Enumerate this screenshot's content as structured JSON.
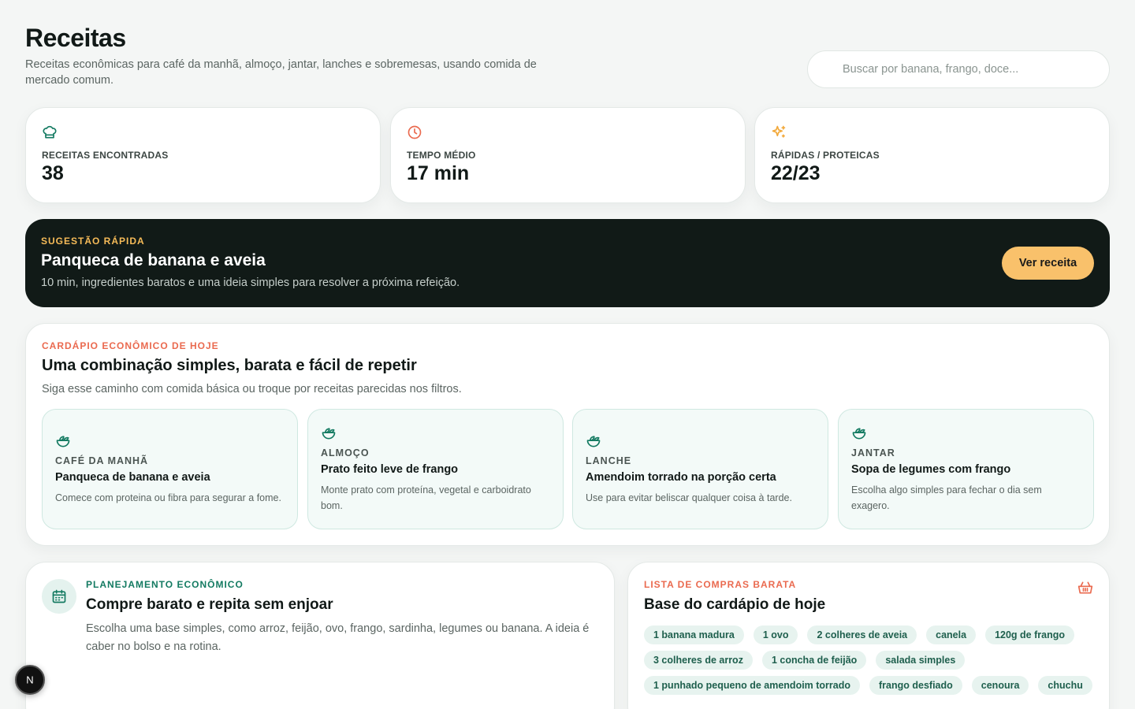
{
  "header": {
    "title": "Receitas",
    "subtitle": "Receitas econômicas para café da manhã, almoço, jantar, lanches e sobremesas, usando comida de mercado comum.",
    "search_placeholder": "Buscar por banana, frango, doce..."
  },
  "stats": [
    {
      "icon": "chef-hat-icon",
      "label": "RECEITAS ENCONTRADAS",
      "value": "38",
      "color": "#137a61"
    },
    {
      "icon": "clock-icon",
      "label": "TEMPO MÉDIO",
      "value": "17 min",
      "color": "#ea6a4f"
    },
    {
      "icon": "sparkles-icon",
      "label": "RÁPIDAS / PROTEICAS",
      "value": "22/23",
      "color": "#f2a93b"
    }
  ],
  "quick": {
    "eyebrow": "SUGESTÃO RÁPIDA",
    "title": "Panqueca de banana e aveia",
    "description": "10 min, ingredientes baratos e uma ideia simples para resolver a próxima refeição.",
    "button_label": "Ver receita"
  },
  "menu": {
    "eyebrow": "CARDÁPIO ECONÔMICO DE HOJE",
    "title": "Uma combinação simples, barata e fácil de repetir",
    "description": "Siga esse caminho com comida básica ou troque por receitas parecidas nos filtros.",
    "meals": [
      {
        "type": "CAFÉ DA MANHÃ",
        "name": "Panqueca de banana e aveia",
        "description": "Comece com proteina ou fibra para segurar a fome."
      },
      {
        "type": "ALMOÇO",
        "name": "Prato feito leve de frango",
        "description": "Monte prato com proteína, vegetal e carboidrato bom."
      },
      {
        "type": "LANCHE",
        "name": "Amendoim torrado na porção certa",
        "description": "Use para evitar beliscar qualquer coisa à tarde."
      },
      {
        "type": "JANTAR",
        "name": "Sopa de legumes com frango",
        "description": "Escolha algo simples para fechar o dia sem exagero."
      }
    ]
  },
  "planning": {
    "eyebrow": "PLANEJAMENTO ECONÔMICO",
    "title": "Compre barato e repita sem enjoar",
    "description": "Escolha uma base simples, como arroz, feijão, ovo, frango, sardinha, legumes ou banana. A ideia é caber no bolso e na rotina."
  },
  "shopping": {
    "eyebrow": "LISTA DE COMPRAS BARATA",
    "title": "Base do cardápio de hoje",
    "items": [
      "1 banana madura",
      "1 ovo",
      "2 colheres de aveia",
      "canela",
      "120g de frango",
      "3 colheres de arroz",
      "1 concha de feijão",
      "salada simples",
      "1 punhado pequeno de amendoim torrado",
      "frango desfiado",
      "cenoura",
      "chuchu"
    ]
  },
  "dev_badge": {
    "letter": "N"
  }
}
